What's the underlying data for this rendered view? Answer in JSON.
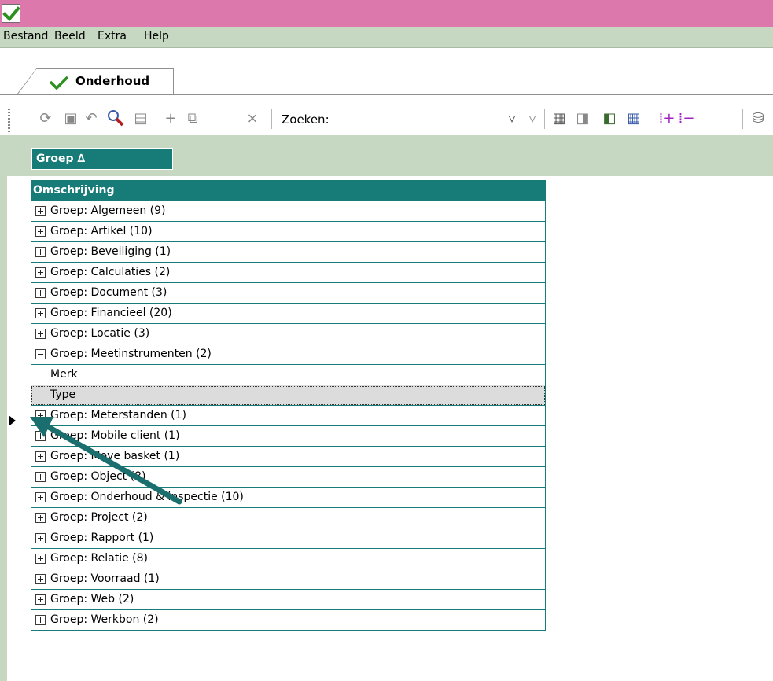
{
  "window": {
    "accent_color": "#dc78ac"
  },
  "menu": {
    "items": [
      {
        "label": "Bestand"
      },
      {
        "label": "Beeld"
      },
      {
        "label": "Extra"
      },
      {
        "label": "Help"
      }
    ]
  },
  "tabs": [
    {
      "label": "Onderhoud"
    }
  ],
  "toolbar": {
    "search_label": "Zoeken:",
    "search_value": "",
    "icons": [
      "refresh-icon",
      "save-icon",
      "undo-icon",
      "search-icon",
      "columns-icon",
      "add-icon",
      "copy-icon",
      "delete-icon",
      "filter-icon",
      "clear-filter-icon",
      "print-icon",
      "export-icon",
      "import-icon",
      "table-icon",
      "expand-all-icon",
      "collapse-all-icon",
      "database-icon"
    ]
  },
  "grouping": {
    "chip_label": "Groep ∆"
  },
  "grid": {
    "column_header": "Omschrijving",
    "header_color": "#177b78",
    "rows": [
      {
        "type": "group",
        "label": "Groep: Algemeen (9)",
        "expanded": false
      },
      {
        "type": "group",
        "label": "Groep: Artikel (10)",
        "expanded": false
      },
      {
        "type": "group",
        "label": "Groep: Beveiliging (1)",
        "expanded": false
      },
      {
        "type": "group",
        "label": "Groep: Calculaties (2)",
        "expanded": false
      },
      {
        "type": "group",
        "label": "Groep: Document (3)",
        "expanded": false
      },
      {
        "type": "group",
        "label": "Groep: Financieel (20)",
        "expanded": false
      },
      {
        "type": "group",
        "label": "Groep: Locatie (3)",
        "expanded": false
      },
      {
        "type": "group",
        "label": "Groep: Meetinstrumenten (2)",
        "expanded": true
      },
      {
        "type": "child",
        "label": "Merk",
        "selected": false
      },
      {
        "type": "child",
        "label": "Type",
        "selected": true
      },
      {
        "type": "group",
        "label": "Groep: Meterstanden (1)",
        "expanded": false
      },
      {
        "type": "group",
        "label": "Groep: Mobile client (1)",
        "expanded": false
      },
      {
        "type": "group",
        "label": "Groep: Move basket (1)",
        "expanded": false
      },
      {
        "type": "group",
        "label": "Groep: Object (8)",
        "expanded": false
      },
      {
        "type": "group",
        "label": "Groep: Onderhoud & inspectie (10)",
        "expanded": false
      },
      {
        "type": "group",
        "label": "Groep: Project (2)",
        "expanded": false
      },
      {
        "type": "group",
        "label": "Groep: Rapport (1)",
        "expanded": false
      },
      {
        "type": "group",
        "label": "Groep: Relatie (8)",
        "expanded": false
      },
      {
        "type": "group",
        "label": "Groep: Voorraad (1)",
        "expanded": false
      },
      {
        "type": "group",
        "label": "Groep: Web (2)",
        "expanded": false
      },
      {
        "type": "group",
        "label": "Groep: Werkbon (2)",
        "expanded": false
      }
    ]
  },
  "annotation": {
    "arrow_color": "#1a6e6d"
  }
}
